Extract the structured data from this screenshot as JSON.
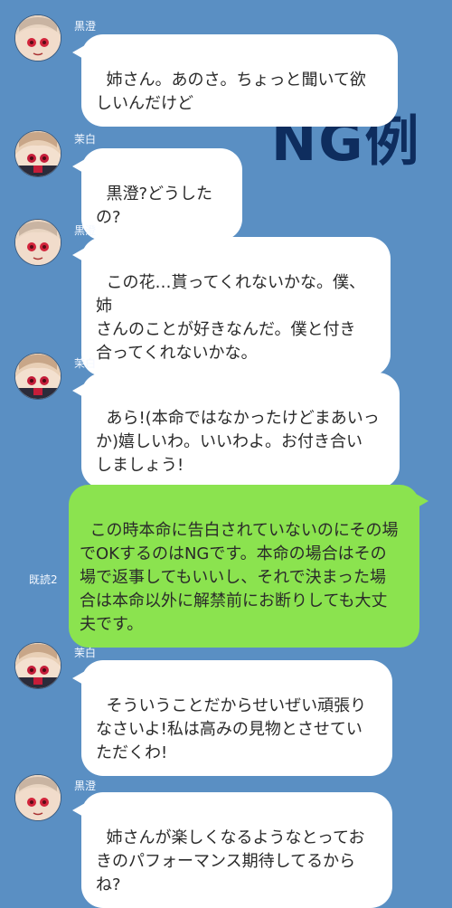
{
  "overlay": {
    "ng_label": "NG例"
  },
  "messages": [
    {
      "sender": "黒澄",
      "text": "姉さん。あのさ。ちょっと聞いて欲\nしいんだけど"
    },
    {
      "sender": "茉白",
      "text": "黒澄?どうしたの?"
    },
    {
      "sender": "黒澄",
      "text": "この花…貰ってくれないかな。僕、姉\nさんのことが好きなんだ。僕と付き\n合ってくれないかな。"
    },
    {
      "sender": "茉白",
      "text": "あら!(本命ではなかったけどまあいっ\nか)嬉しいわ。いいわよ。お付き合い\nしましょう!"
    },
    {
      "sender": "",
      "text": "この時本命に告白されていないのにその場\nでOKするのはNGです。本命の場合はその\n場で返事してもいいし、それで決まった場\n合は本命以外に解禁前にお断りしても大丈\n夫です。",
      "read_label": "既読2"
    },
    {
      "sender": "茉白",
      "text": "そういうことだからせいぜい頑張り\nなさいよ!私は高みの見物とさせてい\nただくわ!"
    },
    {
      "sender": "黒澄",
      "text": "姉さんが楽しくなるようなとってお\nきのパフォーマンス期待してるから\nね?"
    }
  ],
  "colors": {
    "background": "#5a8fc3",
    "bubble_in": "#ffffff",
    "bubble_out": "#8be34f",
    "ng_text": "#0e2d5e"
  }
}
